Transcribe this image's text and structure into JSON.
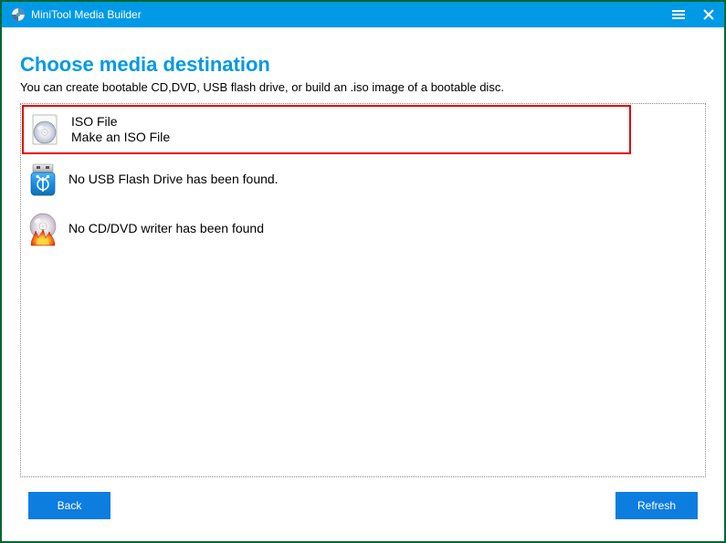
{
  "app": {
    "title": "MiniTool Media Builder"
  },
  "heading": "Choose media destination",
  "subheading": "You can create bootable CD,DVD, USB flash drive, or build an .iso image of a bootable disc.",
  "options": {
    "iso": {
      "title": "ISO File",
      "subtitle": "Make an ISO File"
    },
    "usb": {
      "label": "No USB Flash Drive has been found."
    },
    "cddvd": {
      "label": "No CD/DVD writer has been found"
    }
  },
  "buttons": {
    "back": "Back",
    "refresh": "Refresh"
  }
}
